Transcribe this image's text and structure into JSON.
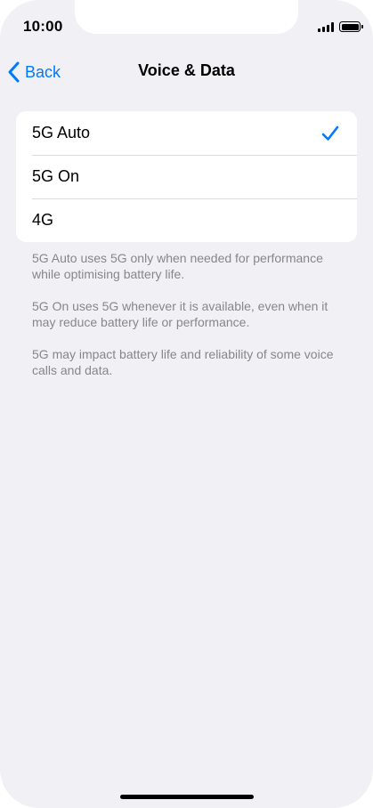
{
  "status_bar": {
    "time": "10:00",
    "signal_icon": "cellular-signal-icon",
    "battery_icon": "battery-icon"
  },
  "nav": {
    "back_label": "Back",
    "back_icon": "chevron-left-icon",
    "title": "Voice & Data"
  },
  "options": [
    {
      "label": "5G Auto",
      "selected": true
    },
    {
      "label": "5G On",
      "selected": false
    },
    {
      "label": "4G",
      "selected": false
    }
  ],
  "footnotes": [
    "5G Auto uses 5G only when needed for performance while optimising battery life.",
    "5G On uses 5G whenever it is available, even when it may reduce battery life or performance.",
    "5G may impact battery life and reliability of some voice calls and data."
  ],
  "colors": {
    "accent": "#007aff",
    "background": "#f0f0f5",
    "footnote_text": "#86868b"
  }
}
